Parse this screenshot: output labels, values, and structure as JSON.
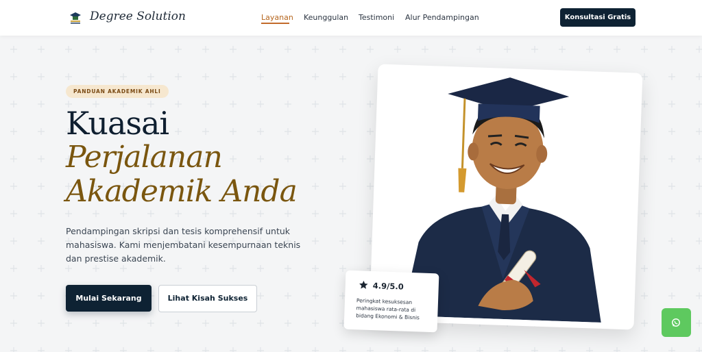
{
  "brand": {
    "name": "Degree Solution",
    "logo_icon": "graduation-logo-icon"
  },
  "nav": {
    "items": [
      {
        "label": "Layanan",
        "active": true
      },
      {
        "label": "Keunggulan",
        "active": false
      },
      {
        "label": "Testimoni",
        "active": false
      },
      {
        "label": "Alur Pendampingan",
        "active": false
      }
    ],
    "cta_label": "Konsultasi Gratis"
  },
  "hero": {
    "eyebrow": "PANDUAN AKADEMIK AHLI",
    "title_line1": "Kuasai",
    "title_line2": "Perjalanan",
    "title_line3": "Akademik Anda",
    "description": "Pendampingan skripsi dan tesis komprehensif untuk mahasiswa. Kami menjembatani kesempurnaan teknis dan prestise akademik.",
    "primary_button": "Mulai Sekarang",
    "secondary_button": "Lihat Kisah Sukses"
  },
  "rating": {
    "value": "4.9/5.0",
    "text": "Peringkat kesuksesan mahasiswa rata-rata di bidang Ekonomi & Bisnis",
    "icon": "star-icon"
  },
  "floating": {
    "icon": "whatsapp-icon"
  },
  "colors": {
    "navy": "#0e2233",
    "gold_italic": "#7a560f",
    "accent_orange": "#c26a2a",
    "eyebrow_bg": "#f6e7cf",
    "whatsapp_green": "#5ec95f"
  }
}
